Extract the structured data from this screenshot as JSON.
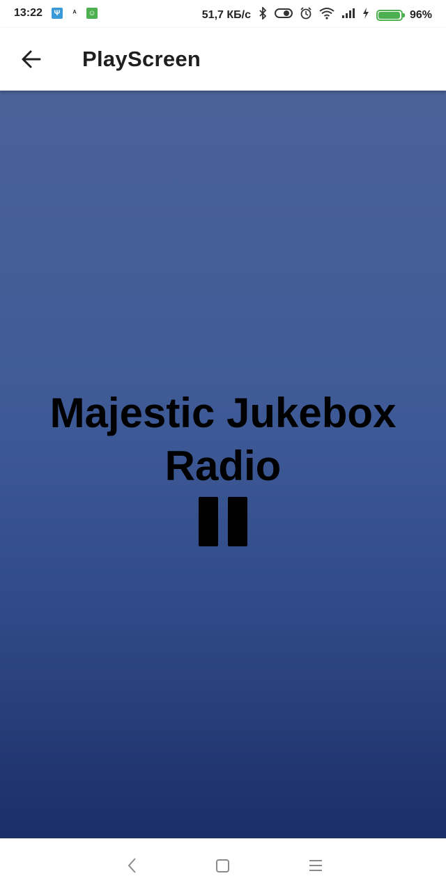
{
  "status_bar": {
    "time": "13:22",
    "network_speed": "51,7 КБ/с",
    "battery_percent": "96%",
    "battery_level": 0.96,
    "battery_color": "#4caf50",
    "notification_icons": [
      "usb-icon",
      "app-notification-icon",
      "android-icon"
    ],
    "system_icons": [
      "bluetooth-icon",
      "toggle-icon",
      "alarm-icon",
      "wifi-icon",
      "signal-icon",
      "charging-icon"
    ]
  },
  "app_bar": {
    "title": "PlayScreen",
    "back_icon": "arrow-back-icon"
  },
  "player": {
    "station_name": "Majestic Jukebox Radio",
    "control_icon": "pause-icon",
    "background_top": "#4a6298",
    "background_bottom": "#1c2e68"
  },
  "nav_bar": {
    "buttons": [
      "back-icon",
      "home-icon",
      "menu-icon"
    ]
  }
}
